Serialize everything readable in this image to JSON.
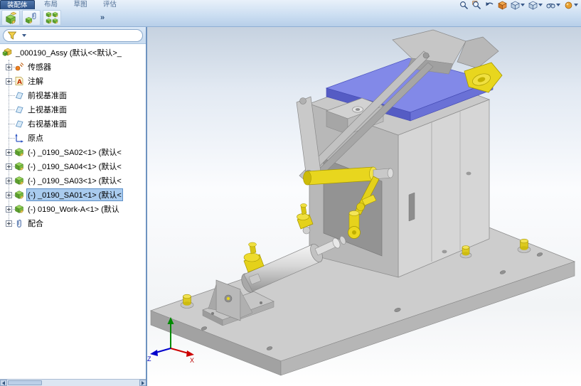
{
  "command_tabs": {
    "items": [
      {
        "label": "装配体",
        "active": true
      },
      {
        "label": "布局",
        "active": false
      },
      {
        "label": "草图",
        "active": false
      },
      {
        "label": "评估",
        "active": false
      }
    ]
  },
  "assembly_toolbar": {
    "icons": [
      "insert-components",
      "mate",
      "linear-component-pattern"
    ],
    "overflow": "»"
  },
  "view_toolbar": {
    "icons": [
      "zoom-to-fit",
      "zoom-area",
      "previous-view",
      "section-view",
      "view-orientation",
      "display-style",
      "hide-show-items",
      "edit-appearance"
    ]
  },
  "feature_tree": {
    "filter": {
      "icon": "selection-filter-funnel"
    },
    "root": {
      "label": "_000190_Assy (默认<<默认>_",
      "icon": "assembly"
    },
    "items": [
      {
        "label": "传感器",
        "icon": "sensors",
        "expandable": true
      },
      {
        "label": "注解",
        "icon": "annotations",
        "expandable": true
      },
      {
        "label": "前视基准面",
        "icon": "plane",
        "expandable": false
      },
      {
        "label": "上视基准面",
        "icon": "plane",
        "expandable": false
      },
      {
        "label": "右视基准面",
        "icon": "plane",
        "expandable": false
      },
      {
        "label": "原点",
        "icon": "origin",
        "expandable": false
      },
      {
        "label": "(-) _0190_SA02<1> (默认<",
        "icon": "component-assembly",
        "expandable": true
      },
      {
        "label": "(-) _0190_SA04<1> (默认<",
        "icon": "component-assembly",
        "expandable": true
      },
      {
        "label": "(-) _0190_SA03<1> (默认<",
        "icon": "component-assembly",
        "expandable": true
      },
      {
        "label": "(-) _0190_SA01<1> (默认<",
        "icon": "component-assembly",
        "expandable": true,
        "selected": true
      },
      {
        "label": "(-) 0190_Work-A<1> (默认",
        "icon": "component-assembly",
        "expandable": true
      },
      {
        "label": "配合",
        "icon": "mates",
        "expandable": true
      }
    ]
  },
  "viewport": {
    "triad": {
      "x_label": "X",
      "z_label": "Z"
    },
    "model_colors": {
      "base_gray": "#c9c9c9",
      "clamp_yellow": "#e8d61e",
      "workpiece_blue": "#8289e8"
    }
  },
  "colors": {
    "selection_fill": "#a9cbee",
    "selection_border": "#5e90c8",
    "panel_divider": "#6e93c0",
    "toolbar_top": "#e9f1fa",
    "toolbar_bottom": "#b7cfe9"
  }
}
